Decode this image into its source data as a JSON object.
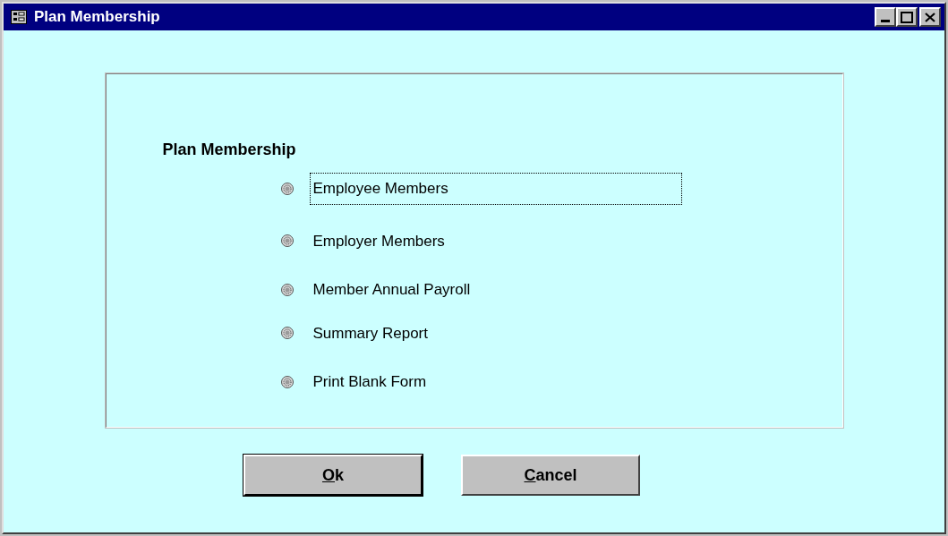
{
  "window": {
    "title": "Plan Membership"
  },
  "group": {
    "heading": "Plan Membership",
    "options": [
      {
        "label": "Employee Members",
        "selected": false,
        "focused": true
      },
      {
        "label": "Employer Members",
        "selected": false,
        "focused": false
      },
      {
        "label": "Member Annual Payroll",
        "selected": false,
        "focused": false
      },
      {
        "label": "Summary Report",
        "selected": false,
        "focused": false
      },
      {
        "label": "Print Blank Form",
        "selected": false,
        "focused": false
      }
    ]
  },
  "buttons": [
    {
      "label": "Ok",
      "default": true
    },
    {
      "label": "Cancel",
      "default": false
    }
  ]
}
